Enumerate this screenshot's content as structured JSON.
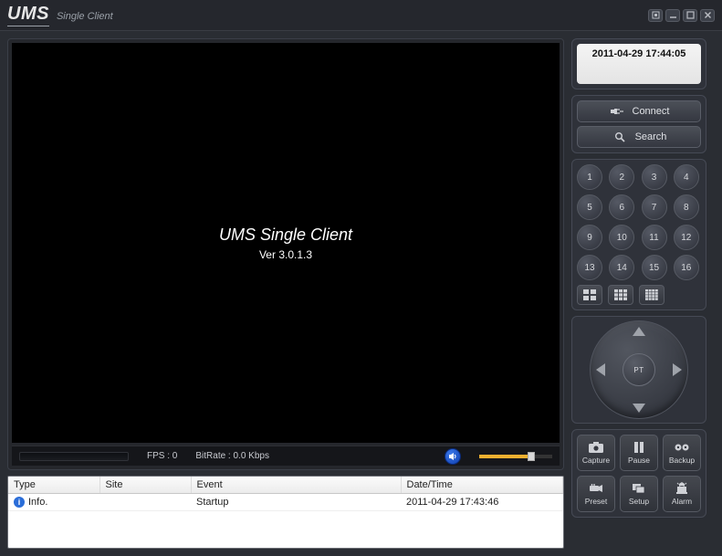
{
  "app": {
    "logo": "UMS",
    "subtitle": "Single Client"
  },
  "video": {
    "title": "UMS Single Client",
    "version": "Ver 3.0.1.3"
  },
  "status": {
    "fps_label": "FPS :",
    "fps_value": "0",
    "bitrate_label": "BitRate :",
    "bitrate_value": "0.0 Kbps"
  },
  "clock": {
    "datetime": "2011-04-29 17:44:05"
  },
  "actions": {
    "connect": "Connect",
    "search": "Search"
  },
  "channels": [
    "1",
    "2",
    "3",
    "4",
    "5",
    "6",
    "7",
    "8",
    "9",
    "10",
    "11",
    "12",
    "13",
    "14",
    "15",
    "16"
  ],
  "ptz": {
    "center": "PT"
  },
  "tools": {
    "capture": "Capture",
    "pause": "Pause",
    "backup": "Backup",
    "preset": "Preset",
    "setup": "Setup",
    "alarm": "Alarm"
  },
  "events": {
    "headers": {
      "type": "Type",
      "site": "Site",
      "event": "Event",
      "datetime": "Date/Time"
    },
    "rows": [
      {
        "type": "Info.",
        "site": "",
        "event": "Startup",
        "datetime": "2011-04-29 17:43:46"
      }
    ]
  }
}
